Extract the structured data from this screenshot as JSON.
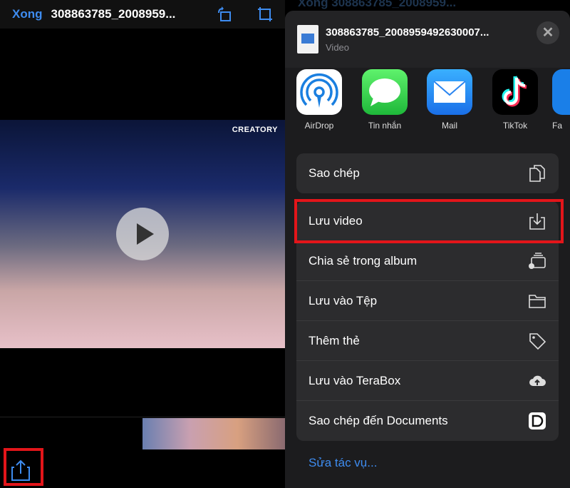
{
  "editor": {
    "done_label": "Xong",
    "title": "308863785_2008959...",
    "video_watermark": "CREATORY"
  },
  "share": {
    "file_name": "308863785_2008959492630007...",
    "file_type": "Video",
    "apps": [
      {
        "label": "AirDrop"
      },
      {
        "label": "Tin nhắn"
      },
      {
        "label": "Mail"
      },
      {
        "label": "TikTok"
      },
      {
        "label": "Fa"
      }
    ],
    "group1": [
      {
        "label": "Sao chép",
        "icon": "copy-icon"
      }
    ],
    "group2": [
      {
        "label": "Lưu video",
        "icon": "save-download-icon"
      },
      {
        "label": "Chia sẻ trong album",
        "icon": "shared-album-icon"
      },
      {
        "label": "Lưu vào Tệp",
        "icon": "folder-icon"
      },
      {
        "label": "Thêm thẻ",
        "icon": "tag-icon"
      },
      {
        "label": "Lưu vào TeraBox",
        "icon": "cloud-upload-icon"
      },
      {
        "label": "Sao chép đến Documents",
        "icon": "documents-app-icon"
      }
    ],
    "edit_actions": "Sửa tác vụ..."
  },
  "colors": {
    "accent": "#3e8cf0",
    "highlight": "#e3151a"
  }
}
